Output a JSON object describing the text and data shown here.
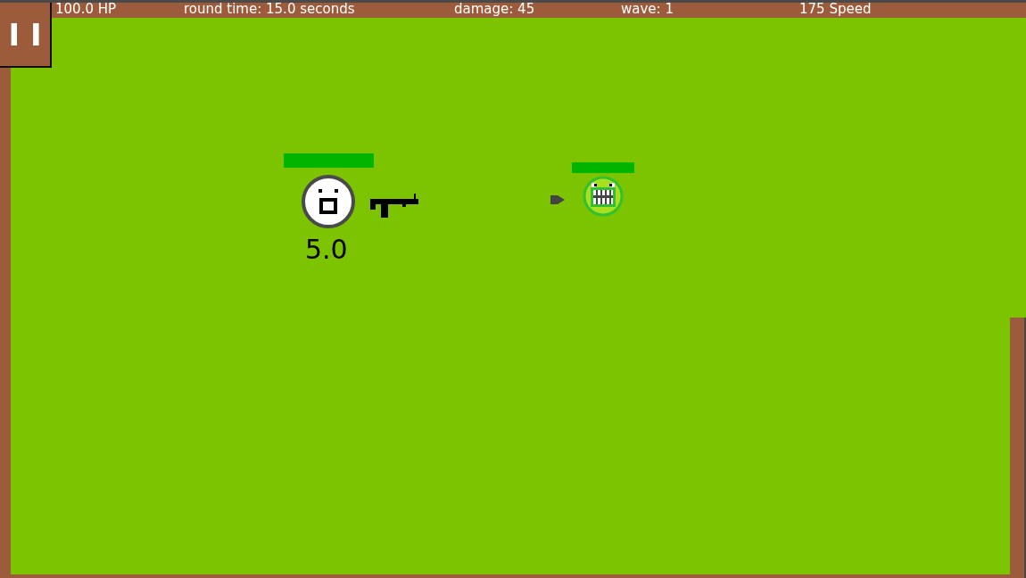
{
  "hud": {
    "hp": "100.0 HP",
    "round_time": "round time: 15.0 seconds",
    "damage": "damage: 45",
    "wave": "wave: 1",
    "speed": "175 Speed"
  },
  "pause_button": {
    "label": "I I"
  },
  "player": {
    "timer": "5.0"
  },
  "enemies": [
    {
      "kind": "grinning-blob"
    }
  ]
}
